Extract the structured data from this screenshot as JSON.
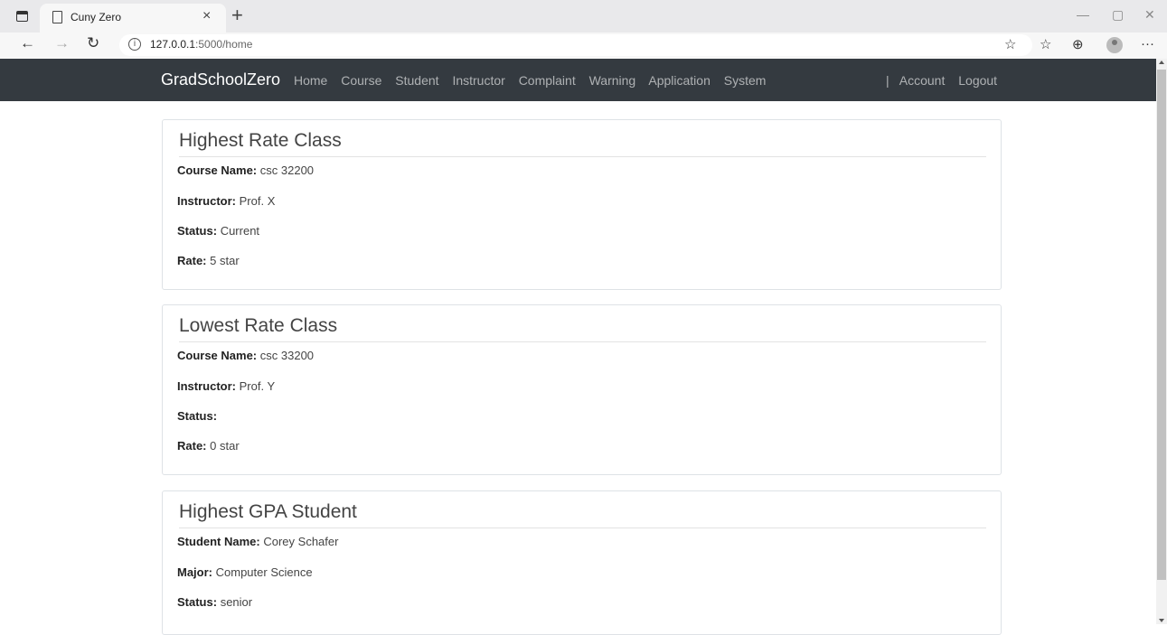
{
  "browser": {
    "tab_title": "Cuny Zero",
    "url_host": "127.0.0.1",
    "url_path": ":5000/home"
  },
  "navbar": {
    "brand": "GradSchoolZero",
    "links": [
      "Home",
      "Course",
      "Student",
      "Instructor",
      "Complaint",
      "Warning",
      "Application",
      "System"
    ],
    "separator": "|",
    "account": "Account",
    "logout": "Logout"
  },
  "cards": [
    {
      "title": "Highest Rate Class",
      "fields": [
        {
          "label": "Course Name:",
          "value": "csc 32200"
        },
        {
          "label": "Instructor:",
          "value": "Prof. X"
        },
        {
          "label": "Status:",
          "value": "Current"
        },
        {
          "label": "Rate:",
          "value": "5 star"
        }
      ]
    },
    {
      "title": "Lowest Rate Class",
      "fields": [
        {
          "label": "Course Name:",
          "value": "csc 33200"
        },
        {
          "label": "Instructor:",
          "value": "Prof. Y"
        },
        {
          "label": "Status:",
          "value": ""
        },
        {
          "label": "Rate:",
          "value": "0 star"
        }
      ]
    },
    {
      "title": "Highest GPA Student",
      "fields": [
        {
          "label": "Student Name:",
          "value": "Corey Schafer"
        },
        {
          "label": "Major:",
          "value": "Computer Science"
        },
        {
          "label": "Status:",
          "value": "senior"
        }
      ]
    }
  ]
}
